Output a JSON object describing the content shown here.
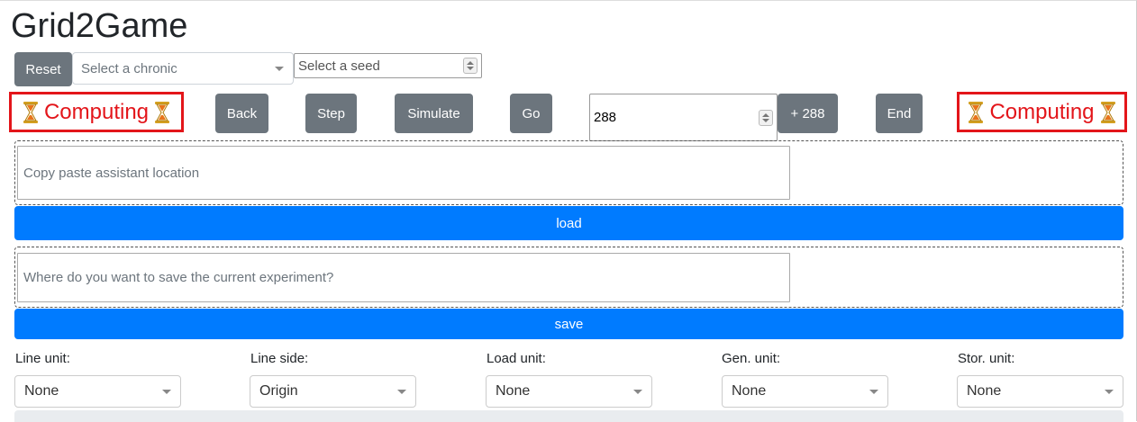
{
  "app": {
    "title": "Grid2Game"
  },
  "controls": {
    "reset_label": "Reset",
    "chronic_placeholder": "Select a chronic",
    "seed_placeholder": "Select a seed"
  },
  "status": {
    "computing_label": "Computing"
  },
  "nav": {
    "back_label": "Back",
    "step_label": "Step",
    "simulate_label": "Simulate",
    "go_label": "Go",
    "step_count_value": "288",
    "plus_label": "+ 288",
    "end_label": "End"
  },
  "assistant": {
    "location_placeholder": "Copy paste assistant location",
    "load_label": "load"
  },
  "experiment": {
    "save_path_placeholder": "Where do you want to save the current experiment?",
    "save_label": "save"
  },
  "units": [
    {
      "label": "Line unit:",
      "value": "None"
    },
    {
      "label": "Line side:",
      "value": "Origin"
    },
    {
      "label": "Load unit:",
      "value": "None"
    },
    {
      "label": "Gen. unit:",
      "value": "None"
    },
    {
      "label": "Stor. unit:",
      "value": "None"
    }
  ],
  "colors": {
    "button_gray": "#6c757d",
    "primary_blue": "#007bff",
    "computing_red": "#e3151a"
  }
}
